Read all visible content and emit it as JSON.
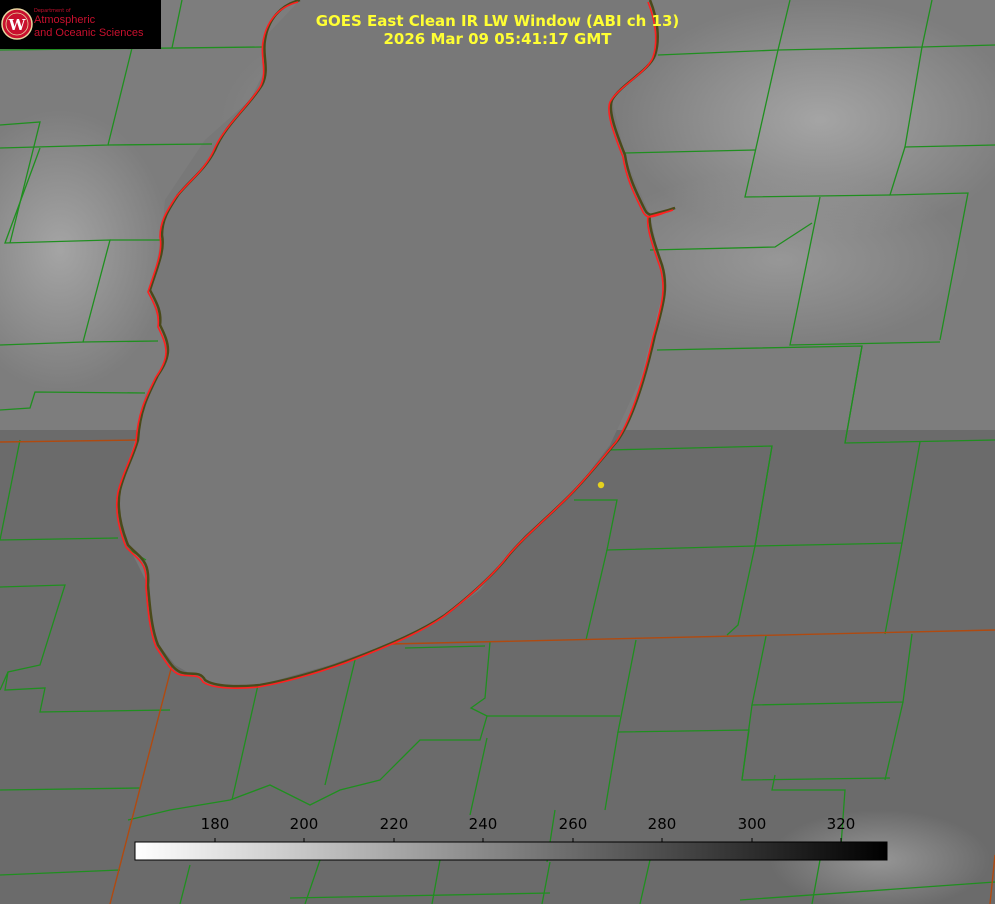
{
  "logo": {
    "department": "Department of",
    "line1": "Atmospheric",
    "line2": "and Oceanic Sciences"
  },
  "title": {
    "line1": "GOES East Clean IR LW Window (ABI ch 13)",
    "line2": "2026 Mar 09 05:41:17 GMT"
  },
  "colorbar": {
    "ticks": [
      "180",
      "200",
      "220",
      "240",
      "260",
      "280",
      "300",
      "320"
    ]
  },
  "colors": {
    "lake_shoreline": "#ff2020",
    "county_lines": "#1f8f1f",
    "state_lines": "#b04a10",
    "title_text": "#ffff33",
    "marker": "#e6d21e",
    "logo_red": "#c8102e"
  }
}
